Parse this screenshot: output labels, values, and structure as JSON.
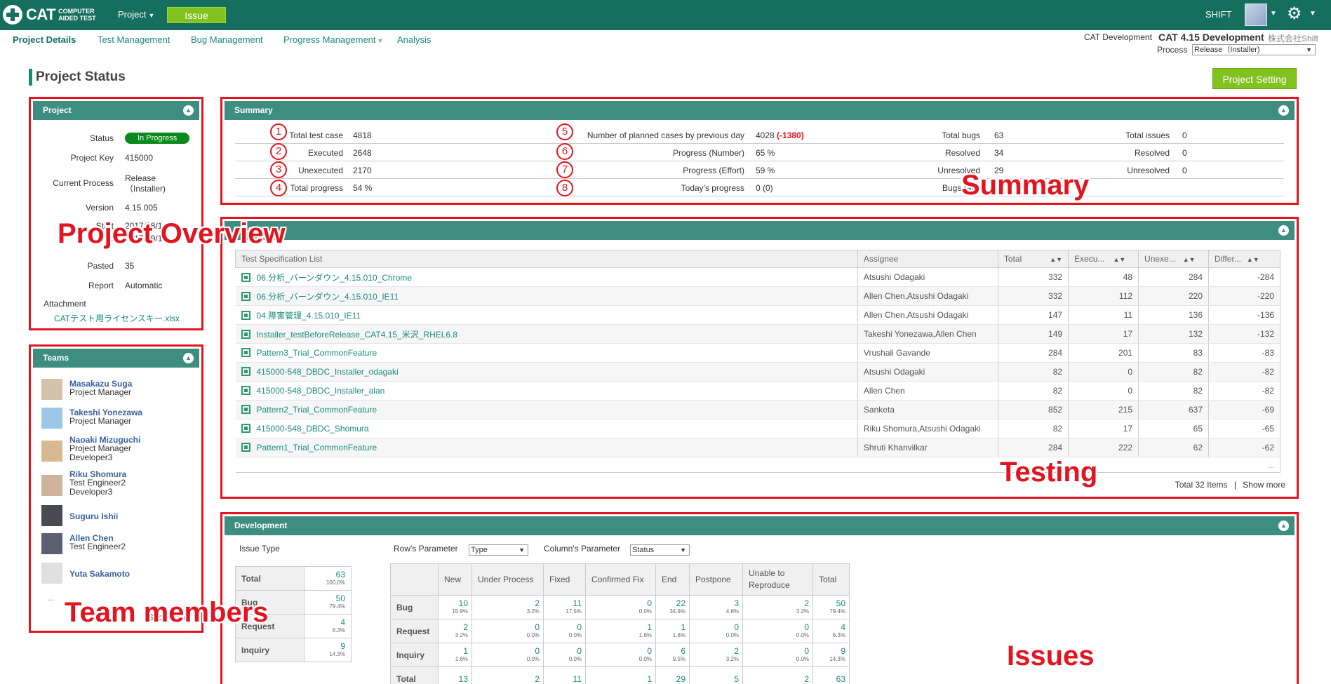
{
  "topbar": {
    "logo_text": "CAT",
    "logo_sub": "COMPUTER AIDED TEST",
    "project_menu": "Project",
    "issue_button": "Issue",
    "user": "SHIFT"
  },
  "subnav": {
    "tabs": [
      "Project Details",
      "Test Management",
      "Bug Management",
      "Progress Management",
      "Analysis"
    ],
    "dev_label": "CAT Development",
    "dev_title": "CAT 4.15 Development",
    "company": "株式会社Shift",
    "process_label": "Process",
    "process_value": "Release（Installer)"
  },
  "page": {
    "title": "Project Status",
    "setting_button": "Project Setting"
  },
  "project": {
    "header": "Project",
    "rows": [
      {
        "key": "Status",
        "value": "In Progress"
      },
      {
        "key": "Project Key",
        "value": "415000"
      },
      {
        "key": "Current Process",
        "value": "Release（Installer)"
      },
      {
        "key": "Version",
        "value": "4.15.005"
      },
      {
        "key": "Start",
        "value": "2017/08/14"
      },
      {
        "key": "End",
        "value": "2017/09/15"
      },
      {
        "key": "Pasted",
        "value": "35"
      },
      {
        "key": "Report",
        "value": "Automatic"
      }
    ],
    "attachment_label": "Attachment",
    "attachment_file": "CATテスト用ライセンスキー.xlsx"
  },
  "teams": {
    "header": "Teams",
    "members": [
      {
        "name": "Masakazu Suga",
        "roles": [
          "Project Manager"
        ]
      },
      {
        "name": "Takeshi Yonezawa",
        "roles": [
          "Project Manager"
        ]
      },
      {
        "name": "Naoaki Mizuguchi",
        "roles": [
          "Project Manager",
          "Developer3"
        ]
      },
      {
        "name": "Riku Shomura",
        "roles": [
          "Test Engineer2",
          "Developer3"
        ]
      },
      {
        "name": "Suguru Ishii",
        "roles": []
      },
      {
        "name": "Allen Chen",
        "roles": [
          "Test Engineer2"
        ]
      },
      {
        "name": "Yuta Sakamoto",
        "roles": []
      }
    ],
    "more": "...",
    "show_more": "Show more"
  },
  "summary": {
    "header": "Summary",
    "rows": [
      {
        "n1": "1",
        "l1": "Total test case",
        "v1": "4818",
        "n2": "5",
        "l2": "Number of planned cases by previous day",
        "v2": "4028",
        "v2_delta": "(-1380)",
        "l3": "Total bugs",
        "v3": "63",
        "l4": "Total issues",
        "v4": "0"
      },
      {
        "n1": "2",
        "l1": "Executed",
        "v1": "2648",
        "n2": "6",
        "l2": "Progress (Number)",
        "v2": "65 %",
        "v2_delta": "",
        "l3": "Resolved",
        "v3": "34",
        "l4": "Resolved",
        "v4": "0"
      },
      {
        "n1": "3",
        "l1": "Unexecuted",
        "v1": "2170",
        "n2": "7",
        "l2": "Progress (Effort)",
        "v2": "59 %",
        "v2_delta": "",
        "l3": "Unresolved",
        "v3": "29",
        "l4": "Unresolved",
        "v4": "0"
      },
      {
        "n1": "4",
        "l1": "Total progress",
        "v1": "54 %",
        "n2": "8",
        "l2": "Today's progress",
        "v2": "0 (0)",
        "v2_delta": "",
        "l3": "Bugs ratio",
        "v3": "",
        "l4": "",
        "v4": ""
      }
    ]
  },
  "testing": {
    "header": "Testing",
    "columns": [
      "Test Specification List",
      "Assignee",
      "Total",
      "Execu...",
      "Unexe...",
      "Differ..."
    ],
    "rows": [
      [
        "06.分析_バーンダウン_4.15.010_Chrome",
        "Atsushi Odagaki",
        "332",
        "48",
        "284",
        "-284"
      ],
      [
        "06.分析_バーンダウン_4.15.010_IE11",
        "Allen Chen,Atsushi Odagaki",
        "332",
        "112",
        "220",
        "-220"
      ],
      [
        "04.障害管理_4.15.010_IE11",
        "Allen Chen,Atsushi Odagaki",
        "147",
        "11",
        "136",
        "-136"
      ],
      [
        "Installer_testBeforeRelease_CAT4.15_米沢_RHEL6.8",
        "Takeshi Yonezawa,Allen Chen",
        "149",
        "17",
        "132",
        "-132"
      ],
      [
        "Pattern3_Trial_CommonFeature",
        "Vrushali Gavande",
        "284",
        "201",
        "83",
        "-83"
      ],
      [
        "415000-548_DBDC_Installer_odagaki",
        "Atsushi Odagaki",
        "82",
        "0",
        "82",
        "-82"
      ],
      [
        "415000-548_DBDC_Installer_alan",
        "Allen Chen",
        "82",
        "0",
        "82",
        "-82"
      ],
      [
        "Pattern2_Trial_CommonFeature",
        "Sanketa",
        "852",
        "215",
        "637",
        "-69"
      ],
      [
        "415000-548_DBDC_Shomura",
        "Riku Shomura,Atsushi Odagaki",
        "82",
        "17",
        "65",
        "-65"
      ],
      [
        "Pattern1_Trial_CommonFeature",
        "Shruti Khanvilkar",
        "284",
        "222",
        "62",
        "-62"
      ]
    ],
    "more": "...",
    "total_items": "Total 32 Items",
    "separator": "|",
    "show_more": "Show more"
  },
  "development": {
    "header": "Development",
    "issue_type_label": "Issue Type",
    "row_param_label": "Row's Parameter",
    "row_param_value": "Type",
    "col_param_label": "Column's Parameter",
    "col_param_value": "Status",
    "issue_types": [
      {
        "label": "Total",
        "count": "63",
        "pct": "100.0%"
      },
      {
        "label": "Bug",
        "count": "50",
        "pct": "79.4%"
      },
      {
        "label": "Request",
        "count": "4",
        "pct": "6.3%"
      },
      {
        "label": "Inquiry",
        "count": "9",
        "pct": "14.3%"
      }
    ],
    "matrix_columns": [
      "",
      "New",
      "Under Process",
      "Fixed",
      "Confirmed Fix",
      "End",
      "Postpone",
      "Unable to Reproduce",
      "Total"
    ],
    "matrix_rows": [
      {
        "label": "Bug",
        "cells": [
          [
            "10",
            "15.9%"
          ],
          [
            "2",
            "3.2%"
          ],
          [
            "11",
            "17.5%"
          ],
          [
            "0",
            "0.0%"
          ],
          [
            "22",
            "34.9%"
          ],
          [
            "3",
            "4.8%"
          ],
          [
            "2",
            "3.2%"
          ],
          [
            "50",
            "79.4%"
          ]
        ]
      },
      {
        "label": "Request",
        "cells": [
          [
            "2",
            "3.2%"
          ],
          [
            "0",
            "0.0%"
          ],
          [
            "0",
            "0.0%"
          ],
          [
            "1",
            "1.6%"
          ],
          [
            "1",
            "1.6%"
          ],
          [
            "0",
            "0.0%"
          ],
          [
            "0",
            "0.0%"
          ],
          [
            "4",
            "6.3%"
          ]
        ]
      },
      {
        "label": "Inquiry",
        "cells": [
          [
            "1",
            "1.6%"
          ],
          [
            "0",
            "0.0%"
          ],
          [
            "0",
            "0.0%"
          ],
          [
            "0",
            "0.0%"
          ],
          [
            "6",
            "9.5%"
          ],
          [
            "2",
            "3.2%"
          ],
          [
            "0",
            "0.0%"
          ],
          [
            "9",
            "14.3%"
          ]
        ]
      },
      {
        "label": "Total",
        "cells": [
          [
            "13",
            ""
          ],
          [
            "2",
            ""
          ],
          [
            "11",
            ""
          ],
          [
            "1",
            ""
          ],
          [
            "29",
            ""
          ],
          [
            "5",
            ""
          ],
          [
            "2",
            ""
          ],
          [
            "63",
            ""
          ]
        ]
      }
    ]
  },
  "annotations": {
    "project_overview": "Project Overview",
    "summary": "Summary",
    "testing": "Testing",
    "team_members": "Team members",
    "issues": "Issues"
  },
  "colors": {
    "topbar": "#156e5e",
    "panel_header": "#3d8e81",
    "accent_green": "#82c21f",
    "annotation_red": "#e3141f",
    "link": "#1a8a7a"
  }
}
